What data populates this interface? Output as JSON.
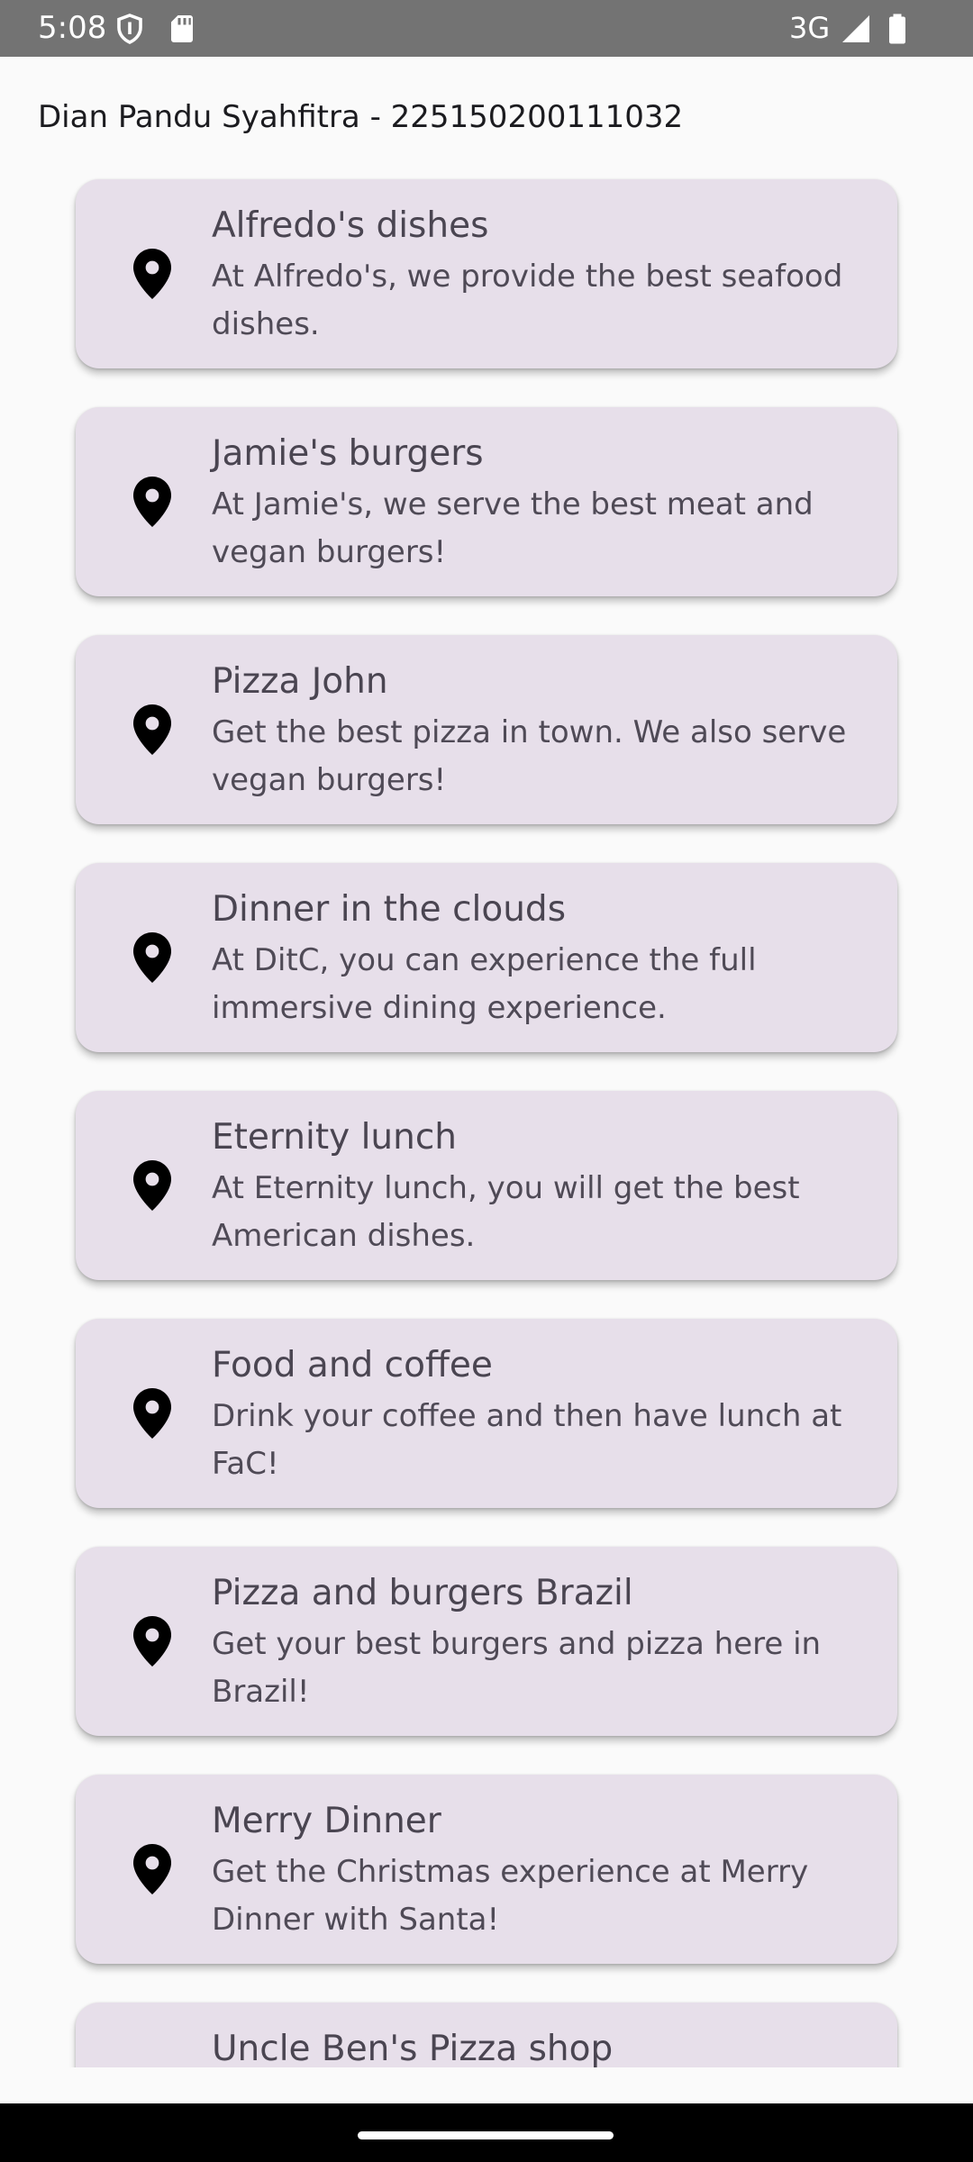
{
  "status_bar": {
    "time": "5:08",
    "network": "3G",
    "icons": [
      "shield-icon",
      "sd-card-icon",
      "signal-icon",
      "battery-icon"
    ]
  },
  "header": {
    "title": "Dian Pandu Syahfitra - 225150200111032"
  },
  "restaurants": [
    {
      "name": "Alfredo's dishes",
      "description": "At Alfredo's, we provide the best seafood dishes.",
      "icon": "location-pin-icon"
    },
    {
      "name": "Jamie's burgers",
      "description": "At Jamie's, we serve the best meat and vegan burgers!",
      "icon": "location-pin-icon"
    },
    {
      "name": "Pizza John",
      "description": "Get the best pizza in town. We also serve vegan burgers!",
      "icon": "location-pin-icon"
    },
    {
      "name": "Dinner in the clouds",
      "description": "At DitC, you can experience the full immersive dining experience.",
      "icon": "location-pin-icon"
    },
    {
      "name": "Eternity lunch",
      "description": "At Eternity lunch, you will get the best American dishes.",
      "icon": "location-pin-icon"
    },
    {
      "name": "Food and coffee",
      "description": "Drink your coffee and then have lunch at FaC!",
      "icon": "location-pin-icon"
    },
    {
      "name": "Pizza and burgers Brazil",
      "description": "Get your best burgers and pizza here in Brazil!",
      "icon": "location-pin-icon"
    },
    {
      "name": "Merry Dinner",
      "description": "Get the Christmas experience at Merry Dinner with Santa!",
      "icon": "location-pin-icon"
    },
    {
      "name": "Uncle Ben's Pizza shop",
      "description": "",
      "icon": "location-pin-icon"
    }
  ],
  "colors": {
    "status_bar": "#737373",
    "background": "#fafafa",
    "card": "#e7dfea",
    "title_text": "#4a4551",
    "desc_text": "#4f4a56",
    "nav_bar": "#000000"
  }
}
